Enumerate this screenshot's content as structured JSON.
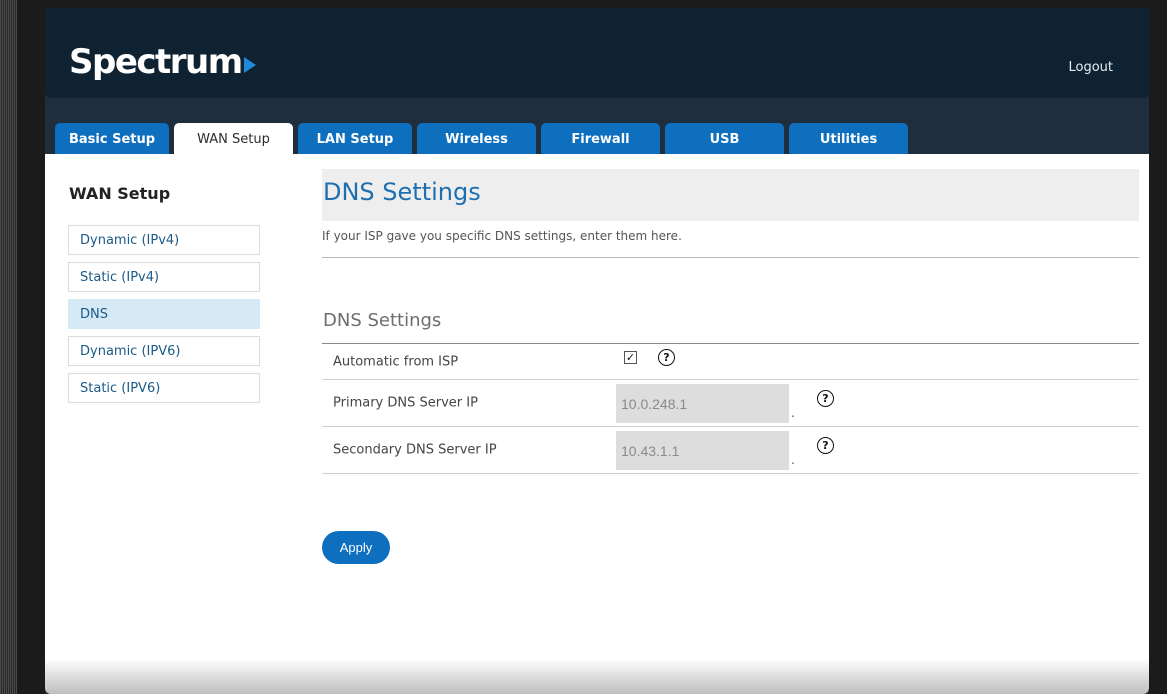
{
  "header": {
    "logo_text": "Spectrum",
    "logout_label": "Logout"
  },
  "tabs": [
    {
      "label": "Basic Setup",
      "active": false
    },
    {
      "label": "WAN Setup",
      "active": true
    },
    {
      "label": "LAN Setup",
      "active": false
    },
    {
      "label": "Wireless",
      "active": false
    },
    {
      "label": "Firewall",
      "active": false
    },
    {
      "label": "USB",
      "active": false
    },
    {
      "label": "Utilities",
      "active": false
    }
  ],
  "sidebar": {
    "title": "WAN Setup",
    "items": [
      {
        "label": "Dynamic (IPv4)",
        "active": false
      },
      {
        "label": "Static (IPv4)",
        "active": false
      },
      {
        "label": "DNS",
        "active": true
      },
      {
        "label": "Dynamic (IPV6)",
        "active": false
      },
      {
        "label": "Static (IPV6)",
        "active": false
      }
    ]
  },
  "main": {
    "page_title": "DNS Settings",
    "description": "If your ISP gave you specific DNS settings, enter them here.",
    "section_title": "DNS Settings",
    "automatic_label": "Automatic from ISP",
    "automatic_checked": true,
    "checkbox_glyph": "✓",
    "help_glyph": "?",
    "primary_label": "Primary DNS Server IP",
    "primary_value": "10.0.248.1",
    "secondary_label": "Secondary DNS Server IP",
    "secondary_value": "10.43.1.1",
    "separator": ".",
    "apply_label": "Apply"
  },
  "colors": {
    "brand_blue": "#0f6fbf",
    "header_bg": "#0f2231",
    "title_blue": "#1d6fb0",
    "sidebar_active": "#d6eaf6"
  }
}
